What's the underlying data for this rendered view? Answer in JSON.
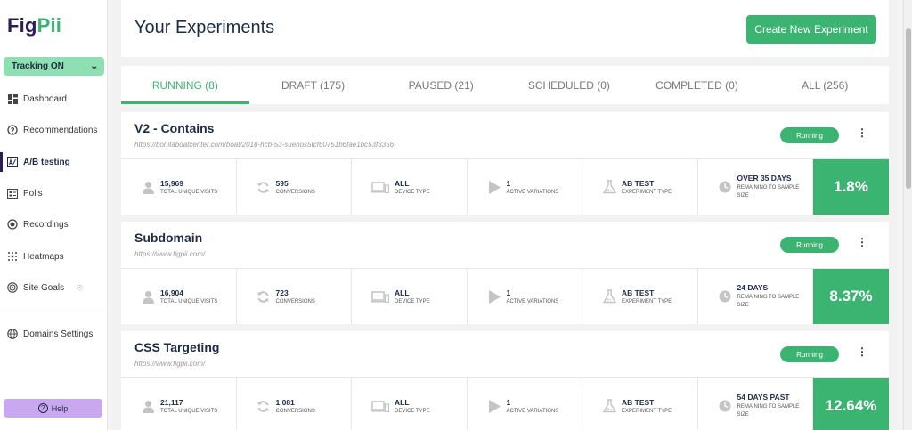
{
  "brand": {
    "part1": "Fig",
    "part2": "Pii"
  },
  "tracking": {
    "label": "Tracking ON"
  },
  "sidebar": {
    "items": [
      {
        "label": "Dashboard",
        "icon": "dashboard-icon"
      },
      {
        "label": "Recommendations",
        "icon": "recommendations-icon"
      },
      {
        "label": "A/B testing",
        "icon": "ab-testing-icon",
        "active": true
      },
      {
        "label": "Polls",
        "icon": "polls-icon"
      },
      {
        "label": "Recordings",
        "icon": "recordings-icon"
      },
      {
        "label": "Heatmaps",
        "icon": "heatmaps-icon"
      },
      {
        "label": "Site Goals",
        "icon": "site-goals-icon"
      },
      {
        "label": "Domains Settings",
        "icon": "globe-icon"
      }
    ],
    "help": "Help"
  },
  "header": {
    "title": "Your Experiments",
    "create_button": "Create New Experiment"
  },
  "tabs": [
    {
      "label": "RUNNING (8)",
      "active": true
    },
    {
      "label": "DRAFT (175)"
    },
    {
      "label": "PAUSED (21)"
    },
    {
      "label": "SCHEDULED (0)"
    },
    {
      "label": "COMPLETED (0)"
    },
    {
      "label": "ALL (256)"
    }
  ],
  "experiments": [
    {
      "name": "V2 - Contains",
      "url": "https://bonitaboatcenter.com/boat/2018-hcb-53-suenos5fcf60751b6fae1bc53f3356",
      "status": "Running",
      "visits": "15,969",
      "visits_label": "TOTAL UNIQUE VISITS",
      "conversions": "595",
      "conversions_label": "CONVERSIONS",
      "device": "ALL",
      "device_label": "DEVICE TYPE",
      "variations": "1",
      "variations_label": "ACTIVE VARIATIONS",
      "type": "AB TEST",
      "type_label": "EXPERIMENT TYPE",
      "remaining": "OVER 35 DAYS",
      "remaining_label": "REMAINING TO SAMPLE SIZE",
      "rate": "1.8%"
    },
    {
      "name": "Subdomain",
      "url": "https://www.figpii.com/",
      "status": "Running",
      "visits": "16,904",
      "visits_label": "TOTAL UNIQUE VISITS",
      "conversions": "723",
      "conversions_label": "CONVERSIONS",
      "device": "ALL",
      "device_label": "DEVICE TYPE",
      "variations": "1",
      "variations_label": "ACTIVE VARIATIONS",
      "type": "AB TEST",
      "type_label": "EXPERIMENT TYPE",
      "remaining": "24 DAYS",
      "remaining_label": "REMAINING TO SAMPLE SIZE",
      "rate": "8.37%"
    },
    {
      "name": "CSS Targeting",
      "url": "https://www.figpii.com/",
      "status": "Running",
      "visits": "21,117",
      "visits_label": "TOTAL UNIQUE VISITS",
      "conversions": "1,081",
      "conversions_label": "CONVERSIONS",
      "device": "ALL",
      "device_label": "DEVICE TYPE",
      "variations": "1",
      "variations_label": "ACTIVE VARIATIONS",
      "type": "AB TEST",
      "type_label": "EXPERIMENT TYPE",
      "remaining": "54 DAYS PAST",
      "remaining_label": "REMAINING TO SAMPLE SIZE",
      "rate": "12.64%"
    }
  ],
  "colors": {
    "accent": "#3bb371",
    "brand_dark": "#2b1d57",
    "tracking_bg": "#8ee0b3",
    "help_bg": "#c9a8f0"
  }
}
